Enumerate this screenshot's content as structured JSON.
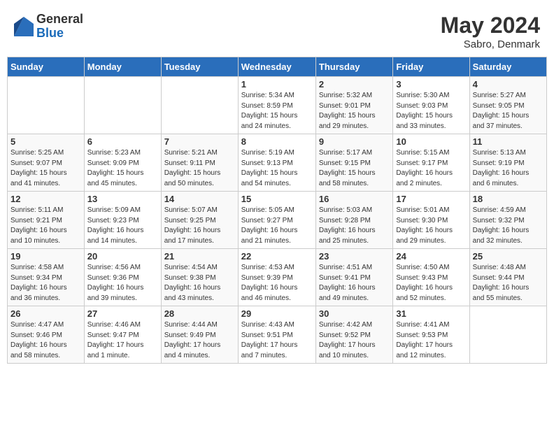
{
  "header": {
    "logo_general": "General",
    "logo_blue": "Blue",
    "month_year": "May 2024",
    "location": "Sabro, Denmark"
  },
  "columns": [
    "Sunday",
    "Monday",
    "Tuesday",
    "Wednesday",
    "Thursday",
    "Friday",
    "Saturday"
  ],
  "weeks": [
    {
      "days": [
        {
          "num": "",
          "info": ""
        },
        {
          "num": "",
          "info": ""
        },
        {
          "num": "",
          "info": ""
        },
        {
          "num": "1",
          "info": "Sunrise: 5:34 AM\nSunset: 8:59 PM\nDaylight: 15 hours\nand 24 minutes."
        },
        {
          "num": "2",
          "info": "Sunrise: 5:32 AM\nSunset: 9:01 PM\nDaylight: 15 hours\nand 29 minutes."
        },
        {
          "num": "3",
          "info": "Sunrise: 5:30 AM\nSunset: 9:03 PM\nDaylight: 15 hours\nand 33 minutes."
        },
        {
          "num": "4",
          "info": "Sunrise: 5:27 AM\nSunset: 9:05 PM\nDaylight: 15 hours\nand 37 minutes."
        }
      ]
    },
    {
      "days": [
        {
          "num": "5",
          "info": "Sunrise: 5:25 AM\nSunset: 9:07 PM\nDaylight: 15 hours\nand 41 minutes."
        },
        {
          "num": "6",
          "info": "Sunrise: 5:23 AM\nSunset: 9:09 PM\nDaylight: 15 hours\nand 45 minutes."
        },
        {
          "num": "7",
          "info": "Sunrise: 5:21 AM\nSunset: 9:11 PM\nDaylight: 15 hours\nand 50 minutes."
        },
        {
          "num": "8",
          "info": "Sunrise: 5:19 AM\nSunset: 9:13 PM\nDaylight: 15 hours\nand 54 minutes."
        },
        {
          "num": "9",
          "info": "Sunrise: 5:17 AM\nSunset: 9:15 PM\nDaylight: 15 hours\nand 58 minutes."
        },
        {
          "num": "10",
          "info": "Sunrise: 5:15 AM\nSunset: 9:17 PM\nDaylight: 16 hours\nand 2 minutes."
        },
        {
          "num": "11",
          "info": "Sunrise: 5:13 AM\nSunset: 9:19 PM\nDaylight: 16 hours\nand 6 minutes."
        }
      ]
    },
    {
      "days": [
        {
          "num": "12",
          "info": "Sunrise: 5:11 AM\nSunset: 9:21 PM\nDaylight: 16 hours\nand 10 minutes."
        },
        {
          "num": "13",
          "info": "Sunrise: 5:09 AM\nSunset: 9:23 PM\nDaylight: 16 hours\nand 14 minutes."
        },
        {
          "num": "14",
          "info": "Sunrise: 5:07 AM\nSunset: 9:25 PM\nDaylight: 16 hours\nand 17 minutes."
        },
        {
          "num": "15",
          "info": "Sunrise: 5:05 AM\nSunset: 9:27 PM\nDaylight: 16 hours\nand 21 minutes."
        },
        {
          "num": "16",
          "info": "Sunrise: 5:03 AM\nSunset: 9:28 PM\nDaylight: 16 hours\nand 25 minutes."
        },
        {
          "num": "17",
          "info": "Sunrise: 5:01 AM\nSunset: 9:30 PM\nDaylight: 16 hours\nand 29 minutes."
        },
        {
          "num": "18",
          "info": "Sunrise: 4:59 AM\nSunset: 9:32 PM\nDaylight: 16 hours\nand 32 minutes."
        }
      ]
    },
    {
      "days": [
        {
          "num": "19",
          "info": "Sunrise: 4:58 AM\nSunset: 9:34 PM\nDaylight: 16 hours\nand 36 minutes."
        },
        {
          "num": "20",
          "info": "Sunrise: 4:56 AM\nSunset: 9:36 PM\nDaylight: 16 hours\nand 39 minutes."
        },
        {
          "num": "21",
          "info": "Sunrise: 4:54 AM\nSunset: 9:38 PM\nDaylight: 16 hours\nand 43 minutes."
        },
        {
          "num": "22",
          "info": "Sunrise: 4:53 AM\nSunset: 9:39 PM\nDaylight: 16 hours\nand 46 minutes."
        },
        {
          "num": "23",
          "info": "Sunrise: 4:51 AM\nSunset: 9:41 PM\nDaylight: 16 hours\nand 49 minutes."
        },
        {
          "num": "24",
          "info": "Sunrise: 4:50 AM\nSunset: 9:43 PM\nDaylight: 16 hours\nand 52 minutes."
        },
        {
          "num": "25",
          "info": "Sunrise: 4:48 AM\nSunset: 9:44 PM\nDaylight: 16 hours\nand 55 minutes."
        }
      ]
    },
    {
      "days": [
        {
          "num": "26",
          "info": "Sunrise: 4:47 AM\nSunset: 9:46 PM\nDaylight: 16 hours\nand 58 minutes."
        },
        {
          "num": "27",
          "info": "Sunrise: 4:46 AM\nSunset: 9:47 PM\nDaylight: 17 hours\nand 1 minute."
        },
        {
          "num": "28",
          "info": "Sunrise: 4:44 AM\nSunset: 9:49 PM\nDaylight: 17 hours\nand 4 minutes."
        },
        {
          "num": "29",
          "info": "Sunrise: 4:43 AM\nSunset: 9:51 PM\nDaylight: 17 hours\nand 7 minutes."
        },
        {
          "num": "30",
          "info": "Sunrise: 4:42 AM\nSunset: 9:52 PM\nDaylight: 17 hours\nand 10 minutes."
        },
        {
          "num": "31",
          "info": "Sunrise: 4:41 AM\nSunset: 9:53 PM\nDaylight: 17 hours\nand 12 minutes."
        },
        {
          "num": "",
          "info": ""
        }
      ]
    }
  ]
}
